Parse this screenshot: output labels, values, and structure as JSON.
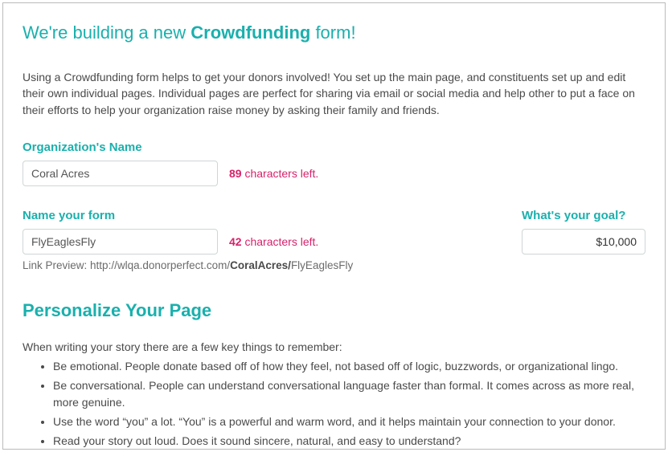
{
  "title": {
    "pre": "We're building a new ",
    "bold": "Crowdfunding",
    "post": " form!"
  },
  "intro": "Using a Crowdfunding form helps to get your donors involved! You set up the main page, and constituents set up and edit their own individual pages. Individual pages are perfect for sharing via email or social media and help other to put a face on their efforts to help your organization raise money by asking their family and friends.",
  "org": {
    "label": "Organization's Name",
    "value": "Coral Acres",
    "chars_left_num": "89",
    "chars_left_text": " characters left."
  },
  "form": {
    "label": "Name your form",
    "value": "FlyEaglesFly",
    "chars_left_num": "42",
    "chars_left_text": " characters left.",
    "link_preview_label": "Link Preview: ",
    "link_preview_base": "http://wlqa.donorperfect.com/",
    "link_preview_org": "CoralAcres/",
    "link_preview_form": "FlyEaglesFly"
  },
  "goal": {
    "label": "What's your goal?",
    "value": "$10,000"
  },
  "personalize": {
    "heading": "Personalize Your Page",
    "intro": "When writing your story there are a few key things to remember:",
    "tips": [
      "Be emotional. People donate based off of how they feel, not based off of logic, buzzwords, or organizational lingo.",
      "Be conversational. People can understand conversational language faster than formal. It comes across as more real, more genuine.",
      "Use the word “you” a lot. “You” is a powerful and warm word, and it helps maintain your connection to your donor.",
      "Read your story out loud. Does it sound sincere, natural, and easy to understand?"
    ]
  }
}
